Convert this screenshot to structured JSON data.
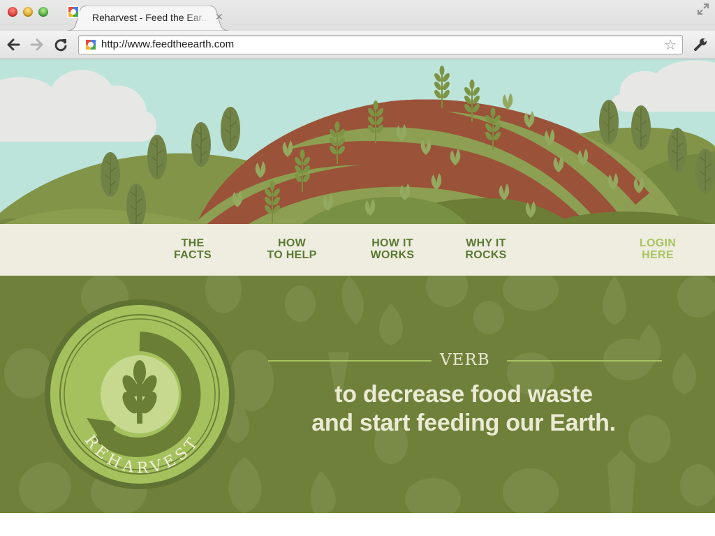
{
  "browser": {
    "tab_title": "Reharvest - Feed the Ear...",
    "tab_close": "✕",
    "url": "http://www.feedtheearth.com",
    "bookmark_star": "☆"
  },
  "nav": {
    "items": [
      {
        "line1": "THE",
        "line2": "FACTS"
      },
      {
        "line1": "HOW",
        "line2": "TO HELP"
      },
      {
        "line1": "HOW IT",
        "line2": "WORKS"
      },
      {
        "line1": "WHY IT",
        "line2": "ROCKS"
      }
    ],
    "login": {
      "line1": "LOGIN",
      "line2": "HERE"
    }
  },
  "hero_section": {
    "badge_text": "REHARVEST",
    "word_type": "VERB",
    "tagline_line1": "to decrease food waste",
    "tagline_line2": "and start feeding our Earth."
  },
  "colors": {
    "sky": "#bde4db",
    "nav_text": "#5a7a33",
    "login_text": "#a7c562",
    "main_bg": "#6f803b",
    "badge_light": "#a4c15e",
    "tagline": "#ebead3"
  },
  "icons": [
    "close-window-dot",
    "minimize-window-dot",
    "zoom-window-dot",
    "favicon-icon",
    "tab-close-icon",
    "fullscreen-icon",
    "back-arrow-icon",
    "forward-arrow-icon",
    "reload-icon",
    "bookmark-star-icon",
    "wrench-icon",
    "wheat-icon"
  ]
}
